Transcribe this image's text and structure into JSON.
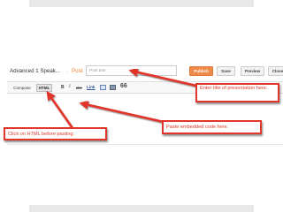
{
  "editor": {
    "title": "Advanced 1 Speak...",
    "separator": "·",
    "post_label": "Post",
    "title_placeholder": "Post title"
  },
  "actions": {
    "publish": "Publish",
    "save": "Save",
    "preview": "Preview",
    "close": "Close"
  },
  "toolbar": {
    "compose_tab": "Compose",
    "html_tab": "HTML",
    "bold": "B",
    "italic": "I",
    "strikethrough": "abc",
    "link": "Link",
    "image_icon": "image-icon",
    "video_icon": "video-icon",
    "quote": "66"
  },
  "callouts": {
    "title": "Enter title of presentation here.",
    "paste": "Paste embedded code here.",
    "html": "Click on HTML before pasting."
  },
  "colors": {
    "annotation_red": "#e2362b",
    "publish_orange": "#f08a4b",
    "post_orange": "#f07f2d"
  }
}
